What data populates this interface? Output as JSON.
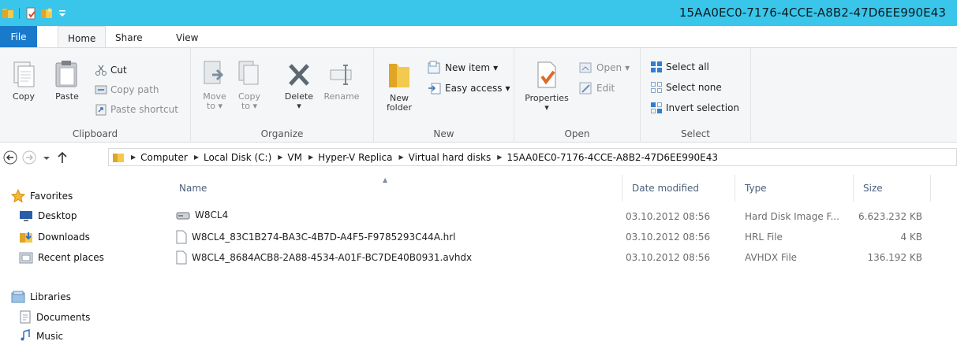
{
  "window": {
    "title": "15AA0EC0-7176-4CCE-A8B2-47D6EE990E43",
    "quick_access": [
      "folder-icon",
      "properties-icon",
      "new-folder-icon",
      "customize-dropdown-icon"
    ]
  },
  "tabs": [
    {
      "label": "File"
    },
    {
      "label": "Home"
    },
    {
      "label": "Share"
    },
    {
      "label": "View"
    }
  ],
  "ribbon": {
    "clipboard": {
      "label": "Clipboard",
      "copy": "Copy",
      "paste": "Paste",
      "cut": "Cut",
      "copy_path": "Copy path",
      "paste_shortcut": "Paste shortcut"
    },
    "organize": {
      "label": "Organize",
      "move_to_1": "Move",
      "move_to_2": "to",
      "copy_to_1": "Copy",
      "copy_to_2": "to",
      "delete": "Delete",
      "rename": "Rename"
    },
    "new": {
      "label": "New",
      "new_folder_1": "New",
      "new_folder_2": "folder",
      "new_item": "New item",
      "easy_access": "Easy access"
    },
    "open": {
      "label": "Open",
      "properties": "Properties",
      "open": "Open",
      "edit": "Edit"
    },
    "select": {
      "label": "Select",
      "select_all": "Select all",
      "select_none": "Select none",
      "invert_selection": "Invert selection"
    }
  },
  "address": {
    "crumbs": [
      "Computer",
      "Local Disk (C:)",
      "VM",
      "Hyper-V Replica",
      "Virtual hard disks",
      "15AA0EC0-7176-4CCE-A8B2-47D6EE990E43"
    ]
  },
  "nav_pane": {
    "favorites": "Favorites",
    "desktop": "Desktop",
    "downloads": "Downloads",
    "recent_places": "Recent places",
    "libraries": "Libraries",
    "documents": "Documents",
    "music": "Music"
  },
  "columns": {
    "name": "Name",
    "date_modified": "Date modified",
    "type": "Type",
    "size": "Size"
  },
  "files": [
    {
      "name": "W8CL4",
      "date": "03.10.2012 08:56",
      "type": "Hard Disk Image F...",
      "size": "6.623.232 KB",
      "icon": "hard-disk-image-icon"
    },
    {
      "name": "W8CL4_83C1B274-BA3C-4B7D-A4F5-F9785293C44A.hrl",
      "date": "03.10.2012 08:56",
      "type": "HRL File",
      "size": "4 KB",
      "icon": "generic-file-icon"
    },
    {
      "name": "W8CL4_8684ACB8-2A88-4534-A01F-BC7DE40B0931.avhdx",
      "date": "03.10.2012 08:56",
      "type": "AVHDX File",
      "size": "136.192 KB",
      "icon": "generic-file-icon"
    }
  ],
  "colors": {
    "titlebar": "#3ac6ea",
    "file_tab": "#1979ca",
    "ribbon_bg": "#f5f6f7",
    "column_header_text": "#4c607a"
  }
}
